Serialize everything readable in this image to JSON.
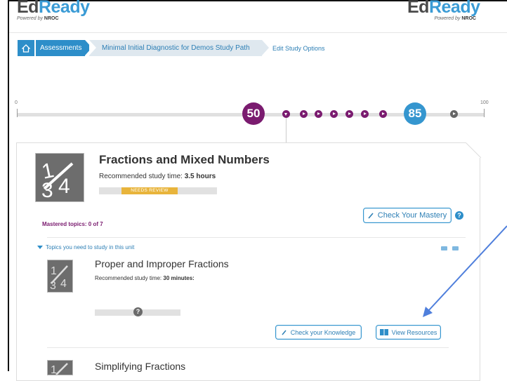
{
  "logo": {
    "name_part1": "Ed",
    "name_part2": "Ready",
    "powered_prefix": "Powered by",
    "powered_brand": "NROC"
  },
  "breadcrumb": {
    "home_icon": "home-icon",
    "assessments": "Assessments",
    "study_path": "Minimal Initial Diagnostic for Demos Study Path",
    "edit_options": "Edit Study Options"
  },
  "scale": {
    "min_label": "0",
    "max_label": "100",
    "current_score": "50",
    "target_score": "85",
    "current_color": "#7a1b6f",
    "target_color": "#3596cf"
  },
  "unit": {
    "title": "Fractions and Mixed Numbers",
    "rec_prefix": "Recommended study time: ",
    "rec_value": "3.5 hours",
    "status": "NEEDS REVIEW",
    "status_color": "#e8b43b",
    "mastered": "Mastered topics: 0 of 7",
    "check_mastery": "Check Your Mastery",
    "help_icon": "?",
    "topics_toggle": "Topics you need to study in this unit"
  },
  "topics": [
    {
      "title": "Proper and Improper Fractions",
      "rec_prefix": "Recommended study time: ",
      "rec_value": "30 minutes:",
      "status_icon": "?",
      "check_knowledge": "Check your Knowledge",
      "view_resources": "View Resources"
    },
    {
      "title": "Simplifying Fractions"
    }
  ],
  "colors": {
    "brand_blue": "#2d8ec9",
    "brand_purple": "#7a1b6f",
    "annotation_arrow": "#4f7fdc"
  }
}
